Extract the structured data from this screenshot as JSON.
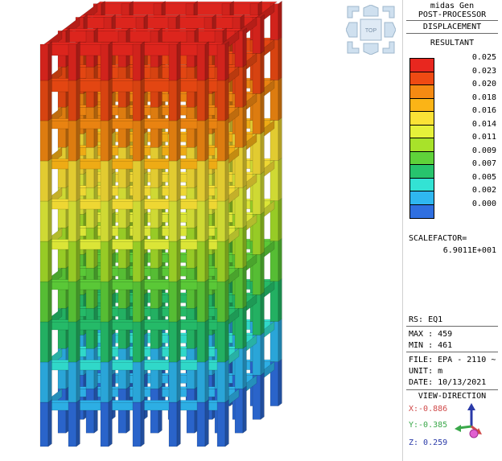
{
  "app": {
    "name": "midas Gen",
    "mode": "POST-PROCESSOR"
  },
  "result": {
    "type": "DISPLACEMENT",
    "component": "RESULTANT"
  },
  "legend": {
    "levels": [
      {
        "value": "0.025",
        "color": "#e8271f"
      },
      {
        "value": "0.023",
        "color": "#ef4a13"
      },
      {
        "value": "0.020",
        "color": "#f58a12"
      },
      {
        "value": "0.018",
        "color": "#fbb416"
      },
      {
        "value": "0.016",
        "color": "#fbe236"
      },
      {
        "value": "0.014",
        "color": "#e6f13a"
      },
      {
        "value": "0.011",
        "color": "#a8e22a"
      },
      {
        "value": "0.009",
        "color": "#5fd23a"
      },
      {
        "value": "0.007",
        "color": "#27c46d"
      },
      {
        "value": "0.005",
        "color": "#33e3d4"
      },
      {
        "value": "0.002",
        "color": "#2fb7f0"
      },
      {
        "value": "0.000",
        "color": "#2f6fe0"
      }
    ]
  },
  "scale": {
    "label": "SCALEFACTOR=",
    "value": "6.9011E+001"
  },
  "info": {
    "rs": "RS: EQ1",
    "max": "MAX : 459",
    "min": "MIN : 461",
    "file": "FILE: EPA - 2110 ~",
    "unit": "UNIT: m",
    "date": "DATE: 10/13/2021"
  },
  "view_direction": {
    "title": "VIEW-DIRECTION",
    "x": "X:-0.886",
    "y": "Y:-0.385",
    "z": "Z: 0.259",
    "x_color": "#d04a4a",
    "y_color": "#3aa84a",
    "z_color": "#2a3aa8"
  },
  "view_cube": {
    "label": "TOP"
  },
  "contour_colors": [
    "#2f6fe0",
    "#2fb7f0",
    "#33e3d4",
    "#27c46d",
    "#5fd23a",
    "#a8e22a",
    "#e6f13a",
    "#fbe236",
    "#fbb416",
    "#f58a12",
    "#ef4a13",
    "#e8271f"
  ]
}
